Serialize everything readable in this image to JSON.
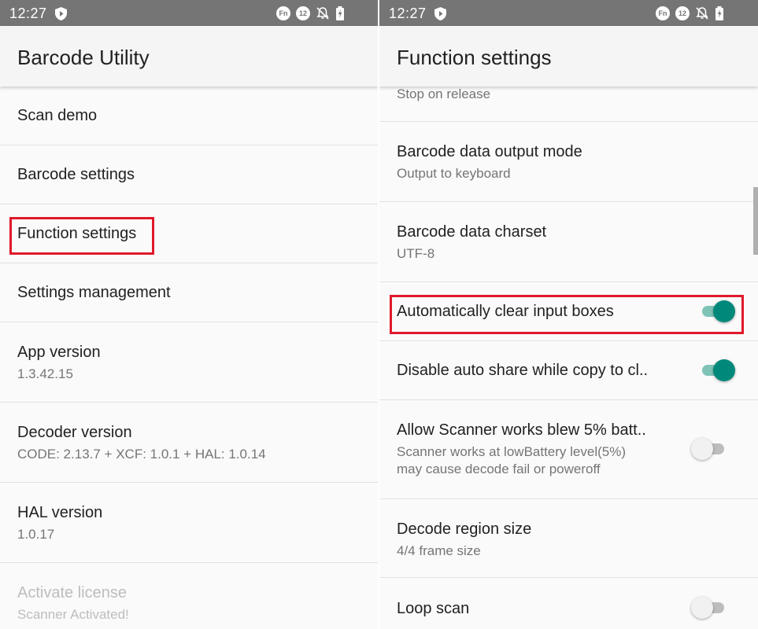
{
  "left": {
    "status": {
      "time": "12:27",
      "fn_badge": "Fn",
      "num_badge": "12"
    },
    "title": "Barcode Utility",
    "items": [
      {
        "title": "Scan demo"
      },
      {
        "title": "Barcode settings"
      },
      {
        "title": "Function settings"
      },
      {
        "title": "Settings management"
      },
      {
        "title": "App version",
        "subtitle": "1.3.42.15"
      },
      {
        "title": "Decoder version",
        "subtitle": "CODE: 2.13.7 + XCF: 1.0.1 + HAL: 1.0.14"
      },
      {
        "title": "HAL version",
        "subtitle": "1.0.17"
      },
      {
        "title": "Activate license",
        "subtitle": "Scanner Activated!"
      }
    ]
  },
  "right": {
    "status": {
      "time": "12:27",
      "fn_badge": "Fn",
      "num_badge": "12"
    },
    "title": "Function settings",
    "items": [
      {
        "subtitle": "Stop on release"
      },
      {
        "title": "Barcode data output mode",
        "subtitle": "Output to keyboard"
      },
      {
        "title": "Barcode data charset",
        "subtitle": "UTF-8"
      },
      {
        "title": "Automatically clear input boxes",
        "toggle": "on"
      },
      {
        "title": "Disable auto share while copy to cl..",
        "toggle": "on"
      },
      {
        "title": "Allow Scanner works blew 5% batt..",
        "subtitle_line1": "Scanner works at lowBattery level(5%)",
        "subtitle_line2": "may cause decode fail or poweroff",
        "toggle": "off"
      },
      {
        "title": "Decode region size",
        "subtitle": "4/4 frame size"
      },
      {
        "title": "Loop scan",
        "toggle": "off"
      }
    ]
  },
  "colors": {
    "status_bar": "#757575",
    "accent": "#00897b",
    "highlight": "#e0192a"
  },
  "icons": [
    "shield-icon",
    "fn-badge-icon",
    "number-badge-icon",
    "notifications-off-icon",
    "battery-charging-icon"
  ]
}
